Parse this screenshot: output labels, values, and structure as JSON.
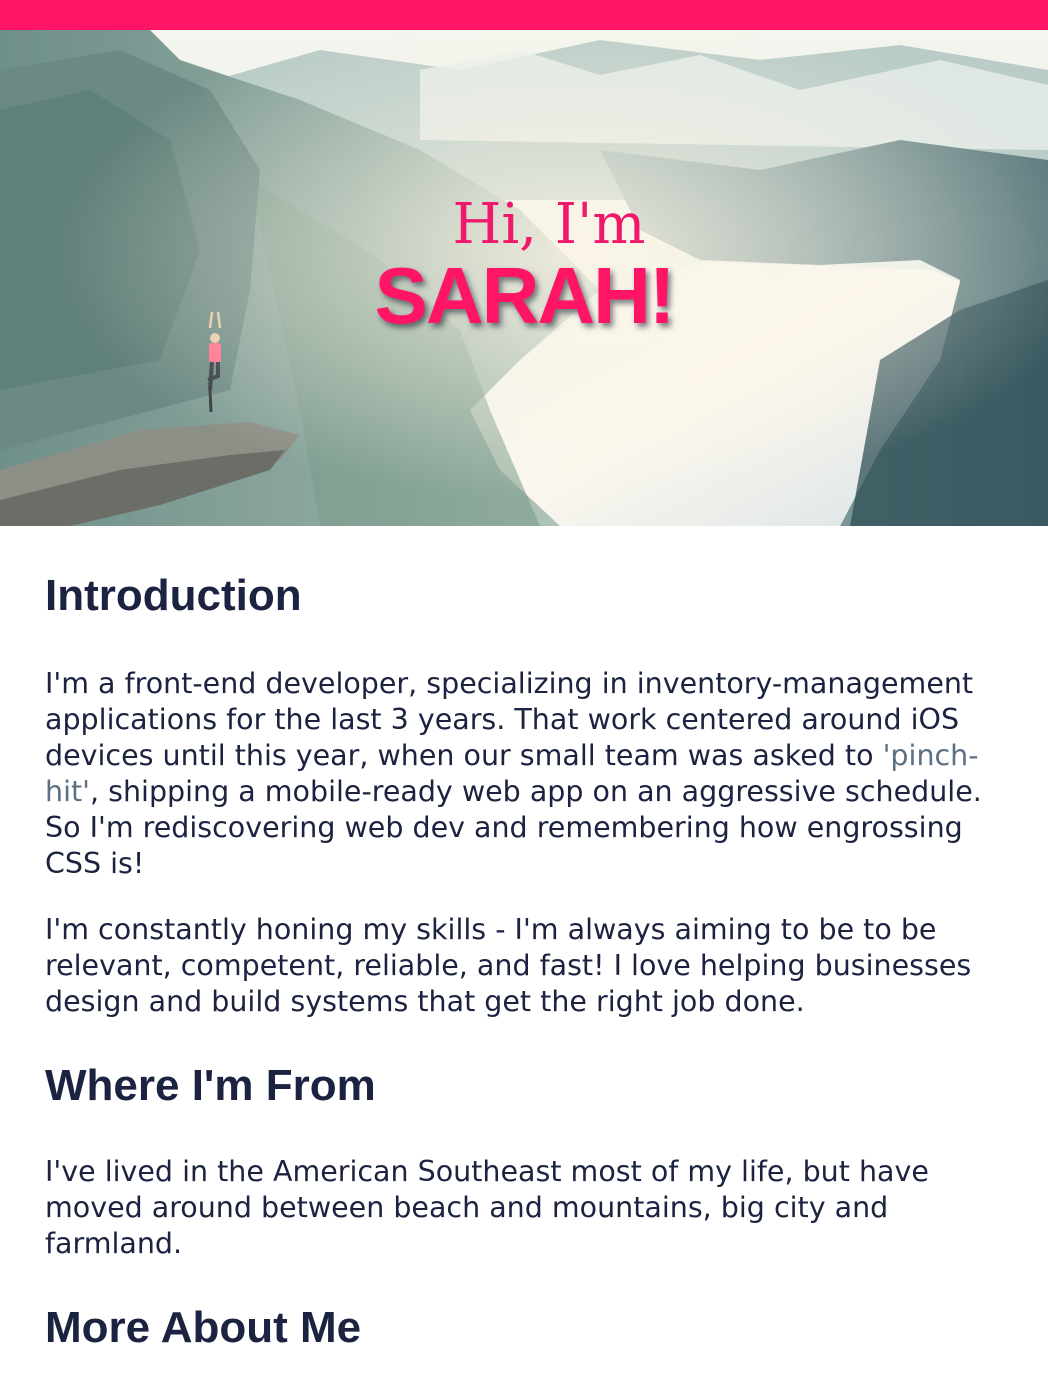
{
  "colors": {
    "accent": "#ff1466",
    "text": "#1c2340",
    "highlight": "#5b7084"
  },
  "hero": {
    "greeting": "Hi, I'm",
    "name": "SARAH!"
  },
  "sections": {
    "introduction": {
      "heading": "Introduction",
      "p1_before": "I'm a front-end developer, specializing in inventory-management applications for the last 3 years. That work centered around iOS devices until this year, when our small team was asked to ",
      "p1_highlight": "'pinch-hit'",
      "p1_after": ", shipping a mobile-ready web app on an aggressive schedule. So I'm rediscovering web dev and remembering how engrossing CSS is!",
      "p2": "I'm constantly honing my skills - I'm always aiming to be to be relevant, competent, reliable, and fast! I love helping businesses design and build systems that get the right job done."
    },
    "where_from": {
      "heading": "Where I'm From",
      "p1": "I've lived in the American Southeast most of my life, but have moved around between beach and mountains, big city and farmland."
    },
    "more_about": {
      "heading": "More About Me"
    }
  }
}
